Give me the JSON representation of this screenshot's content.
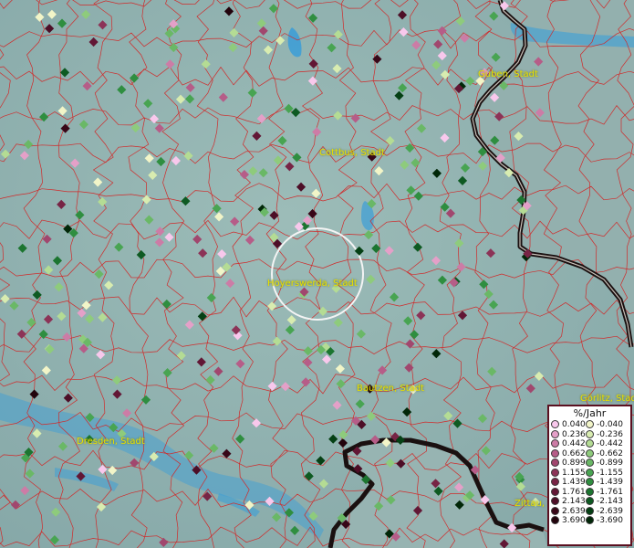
{
  "map": {
    "colors": {
      "background": "#8fb0b0",
      "water": "#3a9ed8",
      "boundary": "#d02a2a",
      "border": "#1a1010",
      "label": "#e8e000",
      "circle": "#ffffff"
    },
    "cities": [
      {
        "name": "Guben, Stadt"
      },
      {
        "name": "Cottbus, Stadt"
      },
      {
        "name": "Hoyerswerda, Stadt"
      },
      {
        "name": "Bautzen, Stadt"
      },
      {
        "name": "Görlitz, Stadt"
      },
      {
        "name": "Dresden, Stadt"
      },
      {
        "name": "Zittau, S"
      }
    ]
  },
  "legend": {
    "title": "%/Jahr",
    "positive": {
      "values": [
        "0.040",
        "0.236",
        "0.442",
        "0.662",
        "0.899",
        "1.155",
        "1.439",
        "1.761",
        "2.143",
        "2.639",
        "3.690"
      ],
      "colors": [
        "#f8c8ec",
        "#e4a0c8",
        "#cc7ca6",
        "#b65d88",
        "#a1476e",
        "#8c3357",
        "#772445",
        "#621735",
        "#4d0e27",
        "#380718",
        "#22030c"
      ]
    },
    "negative": {
      "values": [
        "-0.040",
        "-0.236",
        "-0.442",
        "-0.662",
        "-0.899",
        "-1.155",
        "-1.439",
        "-1.761",
        "-2.143",
        "-2.639",
        "-3.690"
      ],
      "colors": [
        "#f2f5c8",
        "#d8ecb0",
        "#b4dc94",
        "#8ecb7c",
        "#6ab866",
        "#48a452",
        "#2f8e40",
        "#1c7530",
        "#0e5a22",
        "#054014",
        "#012708"
      ]
    }
  }
}
